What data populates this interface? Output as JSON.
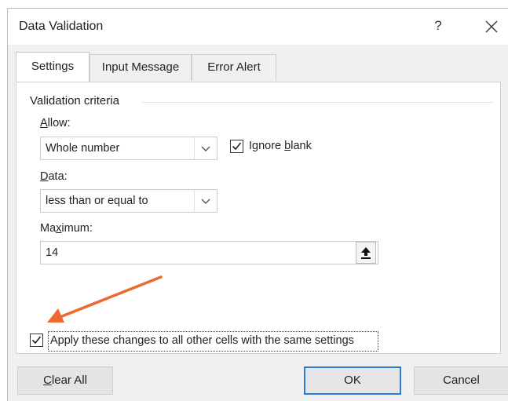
{
  "dialog": {
    "title": "Data Validation",
    "help_glyph": "?"
  },
  "tabs": [
    {
      "label": "Settings",
      "active": true
    },
    {
      "label": "Input Message",
      "active": false
    },
    {
      "label": "Error Alert",
      "active": false
    }
  ],
  "settings": {
    "group_title": "Validation criteria",
    "allow_label_first": "A",
    "allow_label_rest": "llow:",
    "allow_value": "Whole number",
    "ignore_blank_prefix": "Ignore ",
    "ignore_blank_mnemonic": "b",
    "ignore_blank_suffix": "lank",
    "ignore_blank_checked": true,
    "data_label_first": "D",
    "data_label_rest": "ata:",
    "data_value": "less than or equal to",
    "maximum_label_first": "Ma",
    "maximum_label_mnemonic": "x",
    "maximum_label_rest": "imum:",
    "maximum_value": "14",
    "apply_label_first": "Apply these changes to all other cells with the same settings",
    "apply_checked": true
  },
  "annotation": {
    "arrow_color": "#ec6a32"
  },
  "buttons": {
    "clear_all_mnemonic": "C",
    "clear_all_rest": "lear All",
    "ok": "OK",
    "cancel": "Cancel"
  },
  "colors": {
    "dialog_bg": "#f0f0f0",
    "accent": "#2b7cd3"
  }
}
